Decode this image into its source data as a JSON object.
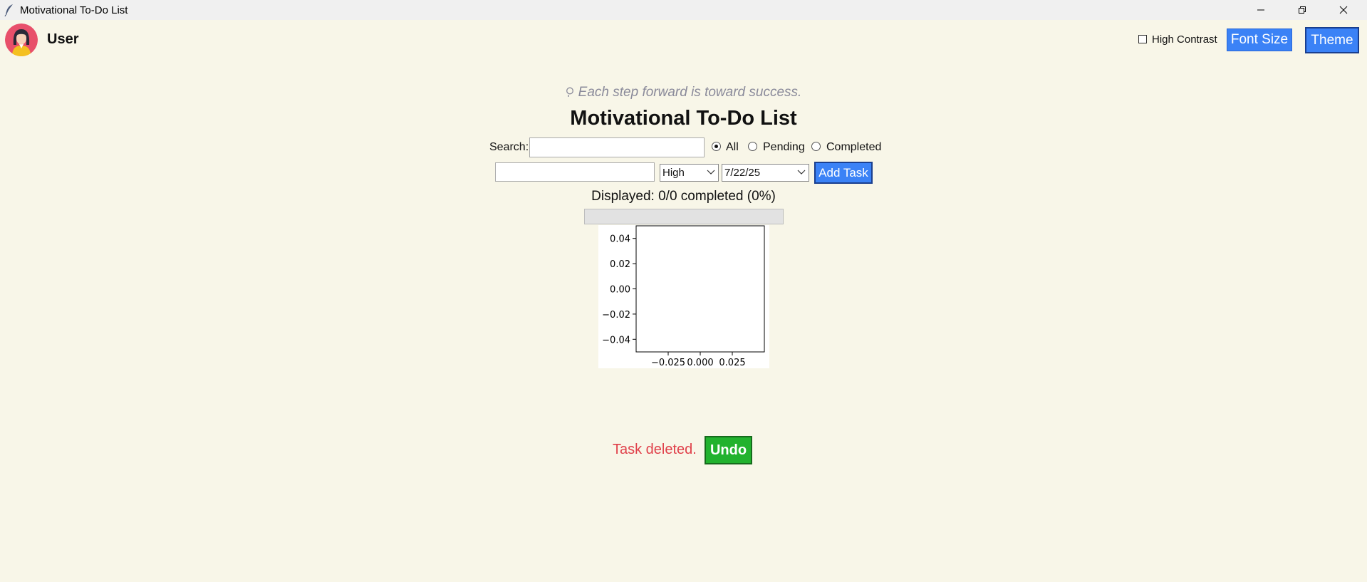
{
  "window": {
    "title": "Motivational To-Do List",
    "controls": [
      "minimize-icon",
      "restore-icon",
      "close-icon"
    ]
  },
  "header": {
    "username": "User",
    "high_contrast_label": "High Contrast",
    "high_contrast_checked": false,
    "font_size_label": "Font Size",
    "theme_label": "Theme"
  },
  "main": {
    "quote": "Each step forward is toward success.",
    "title": "Motivational To-Do List",
    "search": {
      "label": "Search:",
      "value": ""
    },
    "filter": {
      "options": [
        "All",
        "Pending",
        "Completed"
      ],
      "selected": "All"
    },
    "new_task": {
      "value": "",
      "priority": "High",
      "date": "7/22/25",
      "add_label": "Add Task"
    },
    "displayed": "Displayed: 0/0 completed (0%)",
    "progress": 0
  },
  "chart_data": {
    "type": "scatter",
    "series": [],
    "xlim": [
      -0.05,
      0.05
    ],
    "ylim": [
      -0.05,
      0.05
    ],
    "x_ticks": [
      "−0.025",
      "0.000",
      "0.025"
    ],
    "x_tick_values": [
      -0.025,
      0,
      0.025
    ],
    "y_ticks": [
      "0.04",
      "0.02",
      "0.00",
      "−0.02",
      "−0.04"
    ],
    "y_tick_values": [
      0.04,
      0.02,
      0,
      -0.02,
      -0.04
    ],
    "title": "",
    "xlabel": "",
    "ylabel": ""
  },
  "status": {
    "message": "Task deleted.",
    "undo_label": "Undo"
  },
  "colors": {
    "background": "#f8f6e8",
    "accent": "#3b82f6",
    "undo": "#22b22e",
    "error_text": "#e0404a"
  }
}
